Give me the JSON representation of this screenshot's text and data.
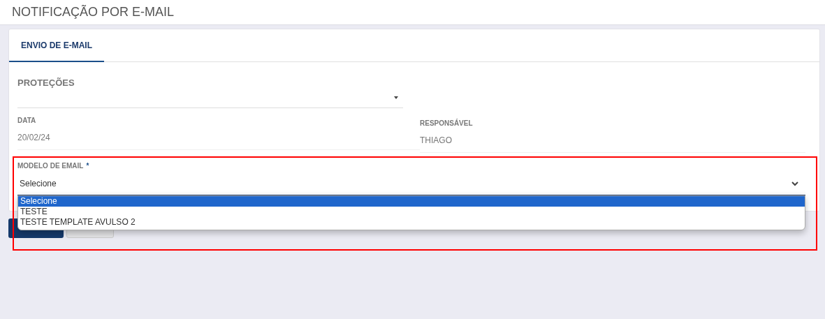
{
  "page": {
    "title": "NOTIFICAÇÃO POR E-MAIL"
  },
  "tabs": [
    {
      "label": "ENVIO DE E-MAIL",
      "selected": true
    }
  ],
  "form": {
    "protecoes": {
      "label": "PROTEÇÕES"
    },
    "data": {
      "label": "DATA",
      "value": "20/02/24"
    },
    "responsavel": {
      "label": "RESPONSÁVEL",
      "value": "THIAGO"
    },
    "modelo_email": {
      "label": "MODELO DE EMAIL",
      "required_mark": "*",
      "value": "Selecione",
      "expanded": true,
      "options": [
        {
          "label": "Selecione",
          "selected": true
        },
        {
          "label": "TESTE",
          "selected": false
        },
        {
          "label": "TESTE TEMPLATE AVULSO 2",
          "selected": false
        }
      ]
    }
  },
  "buttons": [
    {
      "kind": "primary"
    },
    {
      "kind": "secondary"
    }
  ],
  "highlight_frame": true
}
